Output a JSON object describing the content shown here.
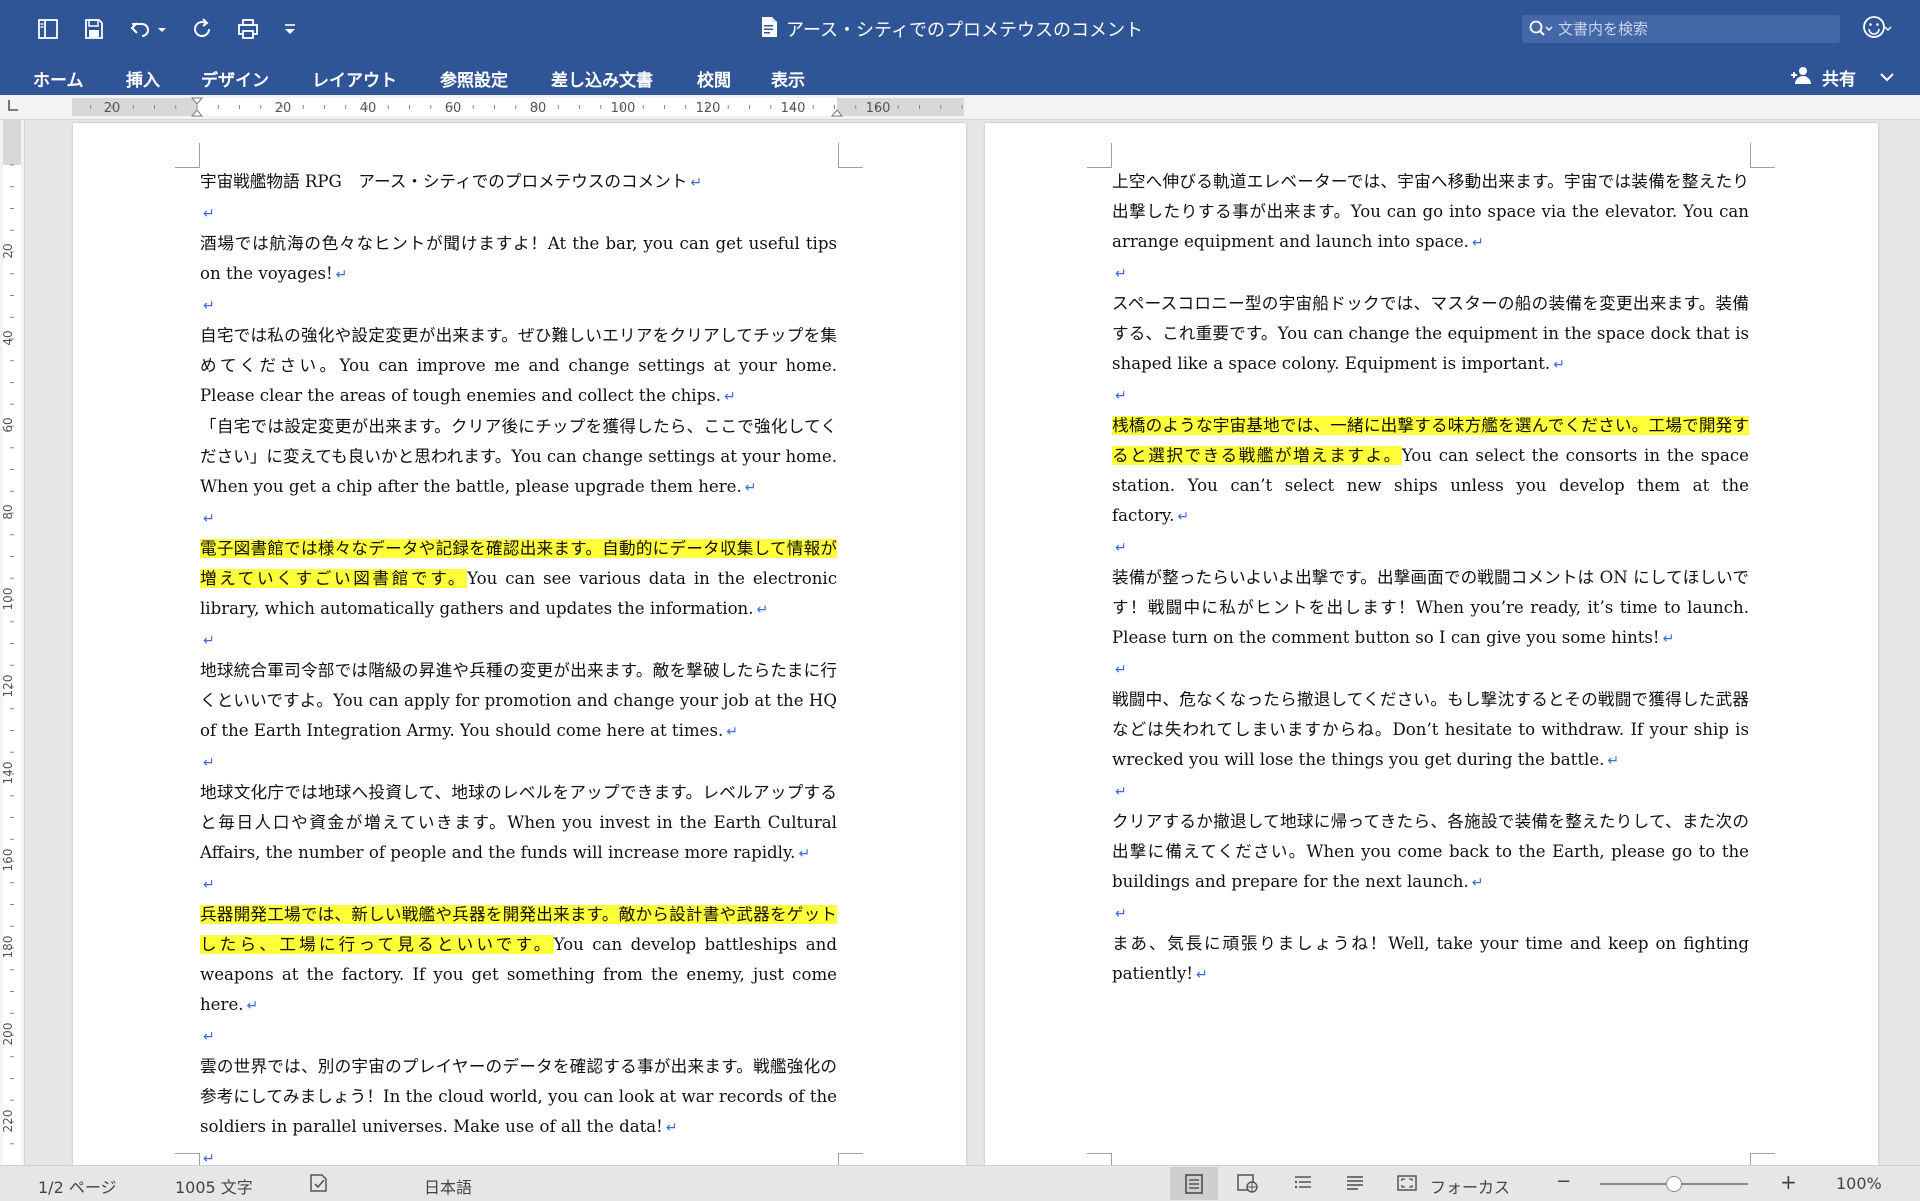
{
  "window": {
    "title": "アース・シティでのプロメテウスのコメント"
  },
  "search": {
    "placeholder": "文書内を検索"
  },
  "ribbon": {
    "tabs": [
      {
        "label": "ホーム"
      },
      {
        "label": "挿入"
      },
      {
        "label": "デザイン"
      },
      {
        "label": "レイアウト"
      },
      {
        "label": "参照設定"
      },
      {
        "label": "差し込み文書"
      },
      {
        "label": "校閲"
      },
      {
        "label": "表示"
      }
    ],
    "share_label": "共有"
  },
  "ruler": {
    "h_labels": [
      "20",
      "20",
      "40",
      "60",
      "80",
      "100",
      "120",
      "140",
      "160"
    ],
    "v_labels": [
      "20",
      "40",
      "60",
      "80",
      "100",
      "120",
      "140",
      "160",
      "180",
      "200",
      "220"
    ]
  },
  "pages": [
    {
      "paragraphs": [
        {
          "segments": [
            {
              "text": "宇宙戦艦物語 RPG　アース・シティでのプロメテウスのコメント"
            }
          ]
        },
        {
          "segments": []
        },
        {
          "segments": [
            {
              "text": "酒場では航海の色々なヒントが聞けますよ！At the bar, you can get useful tips on the voyages!"
            }
          ]
        },
        {
          "segments": []
        },
        {
          "segments": [
            {
              "text": "自宅では私の強化や設定変更が出来ます。ぜひ難しいエリアをクリアしてチップを集めてください。You can improve me and change settings at your home. Please clear the areas of tough enemies and collect the chips."
            }
          ]
        },
        {
          "segments": [
            {
              "text": "「自宅では設定変更が出来ます。クリア後にチップを獲得したら、ここで強化してください」に変えても良いかと思われます。You can change settings at your home. When you get a chip after the battle, please upgrade them here."
            }
          ]
        },
        {
          "segments": []
        },
        {
          "segments": [
            {
              "text": "電子図書館では様々なデータや記録を確認出来ます。自動的にデータ収集して情報が増えていくすごい図書館です。",
              "hl": true
            },
            {
              "text": "You can see various data in the electronic library, which automatically gathers and updates the information."
            }
          ]
        },
        {
          "segments": []
        },
        {
          "segments": [
            {
              "text": "地球統合軍司令部では階級の昇進や兵種の変更が出来ます。敵を撃破したらたまに行くといいですよ。You can apply for promotion and change your job at the HQ of the Earth Integration Army. You should come here at times."
            }
          ]
        },
        {
          "segments": []
        },
        {
          "segments": [
            {
              "text": "地球文化庁では地球へ投資して、地球のレベルをアップできます。レベルアップすると毎日人口や資金が増えていきます。When you invest in the Earth Cultural Affairs, the number of people and the funds will increase more rapidly."
            }
          ]
        },
        {
          "segments": []
        },
        {
          "segments": [
            {
              "text": "兵器開発工場では、新しい戦艦や兵器を開発出来ます。敵から設計書や武器をゲットしたら、工場に行って見るといいです。",
              "hl": true
            },
            {
              "text": "You can develop battleships and weapons at the factory. If you get something from the enemy, just come here."
            }
          ]
        },
        {
          "segments": []
        },
        {
          "segments": [
            {
              "text": "雲の世界では、別の宇宙のプレイヤーのデータを確認する事が出来ます。戦艦強化の参考にしてみましょう！In the cloud world, you can look at war records of the soldiers in parallel universes. Make use of all the data!"
            }
          ]
        },
        {
          "segments": []
        }
      ]
    },
    {
      "paragraphs": [
        {
          "segments": [
            {
              "text": "上空へ伸びる軌道エレベーターでは、宇宙へ移動出来ます。宇宙では装備を整えたり出撃したりする事が出来ます。You can go into space via the elevator. You can arrange equipment and launch into space."
            }
          ]
        },
        {
          "segments": []
        },
        {
          "segments": [
            {
              "text": "スペースコロニー型の宇宙船ドックでは、マスターの船の装備を変更出来ます。装備する、これ重要です。You can change the equipment in the space dock that is shaped like a space colony. Equipment is important."
            }
          ]
        },
        {
          "segments": []
        },
        {
          "segments": [
            {
              "text": "桟橋のような宇宙基地では、一緒に出撃する味方艦を選んでください。工場で開発すると選択できる戦艦が増えますよ。",
              "hl": true
            },
            {
              "text": "You can select the consorts in the space station. You can’t select new ships unless you develop them at the factory."
            }
          ]
        },
        {
          "segments": []
        },
        {
          "segments": [
            {
              "text": "装備が整ったらいよいよ出撃です。出撃画面での戦闘コメントは ON にしてほしいです！戦闘中に私がヒントを出します！When you’re ready, it’s time to launch. Please turn on the comment button so I can give you some hints!"
            }
          ]
        },
        {
          "segments": []
        },
        {
          "segments": [
            {
              "text": "戦闘中、危なくなったら撤退してください。もし撃沈するとその戦闘で獲得した武器などは失われてしまいますからね。Don’t hesitate to withdraw. If your ship is wrecked you will lose the things you get during the battle."
            }
          ]
        },
        {
          "segments": []
        },
        {
          "segments": [
            {
              "text": "クリアするか撤退して地球に帰ってきたら、各施設で装備を整えたりして、また次の出撃に備えてください。When you come back to the Earth, please go to the buildings and prepare for the next launch."
            }
          ]
        },
        {
          "segments": []
        },
        {
          "segments": [
            {
              "text": "まあ、気長に頑張りましょうね！Well, take your time and keep on fighting patiently!"
            }
          ]
        }
      ]
    }
  ],
  "statusbar": {
    "page": "1/2 ページ",
    "word_count": "1005 文字",
    "language": "日本語",
    "focus_label": "フォーカス",
    "zoom_minus": "−",
    "zoom_plus": "+",
    "zoom_level": "100%"
  },
  "colors": {
    "titlebar": "#2f5597",
    "highlight": "#ffff3a",
    "paragraph_mark": "#3a6bd6"
  }
}
